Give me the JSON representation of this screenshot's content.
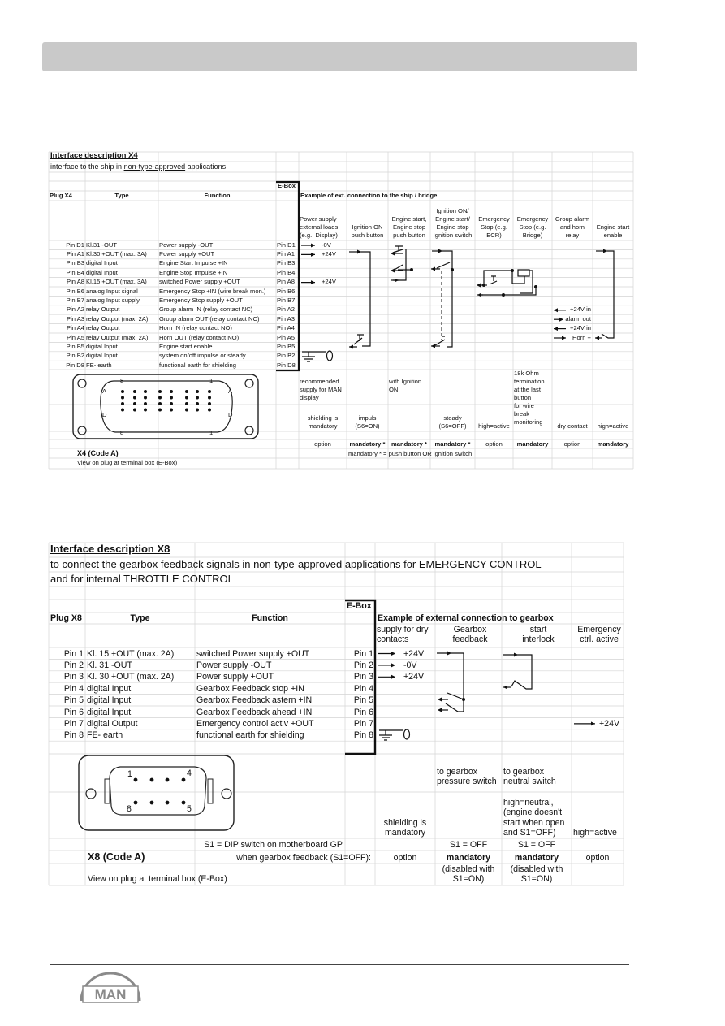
{
  "x4": {
    "title": "Interface description X4",
    "subtitle": [
      "interface to the ship in ",
      "non-type-approved",
      " applications"
    ],
    "ebox": "E-Box",
    "headers": {
      "plug": "Plug X4",
      "type": "Type",
      "function": "Function"
    },
    "example_title": "Example of ext. connection to the ship / bridge",
    "example_columns": [
      "Power supply\nexternal loads\n(e.g.  Display)",
      "Ignition ON\npush button",
      "Engine start,\nEngine stop\npush button",
      "Ignition ON/\nEngine start/\nEngine stop\nIgnition switch",
      "Emergency\nStop (e.g.\nECR)",
      "Emergency\nStop (e.g.\nBridge)",
      "Group alarm\nand horn\nrelay",
      "Engine start\nenable"
    ],
    "pins": [
      {
        "pin": "Pin D1",
        "type": "Kl.31 -OUT",
        "function": "Power supply -OUT",
        "ebox": "Pin D1",
        "supply": "-0V",
        "alarm": ""
      },
      {
        "pin": "Pin A1",
        "type": "Kl.30 +OUT (max. 3A)",
        "function": "Power supply +OUT",
        "ebox": "Pin A1",
        "supply": "+24V",
        "alarm": ""
      },
      {
        "pin": "Pin B3",
        "type": "digital Input",
        "function": "Engine Start Impulse +IN",
        "ebox": "Pin B3",
        "supply": "",
        "alarm": ""
      },
      {
        "pin": "Pin B4",
        "type": "digital Input",
        "function": "Engine Stop Impulse +IN",
        "ebox": "Pin B4",
        "supply": "",
        "alarm": ""
      },
      {
        "pin": "Pin A8",
        "type": "Kl.15 +OUT (max. 3A)",
        "function": "switched Power supply +OUT",
        "ebox": "Pin A8",
        "supply": "+24V",
        "alarm": ""
      },
      {
        "pin": "Pin B6",
        "type": "analog Input signal",
        "function": "Emergency Stop +IN (wire break mon.)",
        "ebox": "Pin B6",
        "supply": "",
        "alarm": ""
      },
      {
        "pin": "Pin B7",
        "type": "analog Input supply",
        "function": "Emergency Stop supply +OUT",
        "ebox": "Pin B7",
        "supply": "",
        "alarm": ""
      },
      {
        "pin": "Pin A2",
        "type": "relay Output",
        "function": "Group alarm IN (relay contact NC)",
        "ebox": "Pin A2",
        "supply": "",
        "alarm": "+24V in"
      },
      {
        "pin": "Pin A3",
        "type": "relay Output (max. 2A)",
        "function": "Group alarm OUT (relay contact NC)",
        "ebox": "Pin A3",
        "supply": "",
        "alarm": "alarm out"
      },
      {
        "pin": "Pin A4",
        "type": "relay Output",
        "function": "Horn IN (relay contact NO)",
        "ebox": "Pin A4",
        "supply": "",
        "alarm": "+24V in"
      },
      {
        "pin": "Pin A5",
        "type": "relay Output (max. 2A)",
        "function": "Horn OUT (relay contact NO)",
        "ebox": "Pin A5",
        "supply": "",
        "alarm": "Horn +"
      },
      {
        "pin": "Pin B5",
        "type": "digital Input",
        "function": "Engine start enable",
        "ebox": "Pin B5",
        "supply": "",
        "alarm": ""
      },
      {
        "pin": "Pin B2",
        "type": "digital Input",
        "function": "system on/off impulse or steady",
        "ebox": "Pin B2",
        "supply": "",
        "alarm": ""
      },
      {
        "pin": "Pin D8",
        "type": "FE- earth",
        "function": "functional earth for shielding",
        "ebox": "Pin D8",
        "supply": "",
        "alarm": ""
      }
    ],
    "notes1": [
      "recommended\nsupply for MAN\ndisplay",
      "",
      "with Ignition\nON",
      "",
      "",
      "18k Ohm\ntermination\nat the last\nbutton\nfor wire\nbreak\nmonitoring",
      "",
      ""
    ],
    "notes2": [
      "shielding is\nmandatory",
      "impuls\n(S6=ON)",
      "",
      "steady\n(S6=OFF)",
      "high=active",
      "",
      "dry contact",
      "high=active"
    ],
    "requirement": [
      "option",
      "mandatory *",
      "mandatory *",
      "mandatory *",
      "option",
      "mandatory",
      "option",
      "mandatory"
    ],
    "footnote": "mandatory * = push button OR ignition switch",
    "connector_title": "X4 (Code A)",
    "connector_caption": "View on plug at terminal box (E-Box)",
    "connector_labels": {
      "top_left": "8",
      "top_right": "1",
      "bottom_left": "8",
      "bottom_right": "1",
      "row_top": "A",
      "row_bottom": "D"
    }
  },
  "x8": {
    "title": "Interface description X8",
    "line2": [
      "to connect the gearbox feedback signals in ",
      "non-type-approved",
      " applications for EMERGENCY CONTROL"
    ],
    "line3": "and for internal THROTTLE CONTROL",
    "ebox": "E-Box",
    "headers": {
      "plug": "Plug X8",
      "type": "Type",
      "function": "Function"
    },
    "example_title": "Example of external connection to gearbox",
    "example_columns": [
      "supply for dry\ncontacts",
      "Gearbox\nfeedback",
      "start\ninterlock",
      "Emergency\nctrl. active"
    ],
    "pins": [
      {
        "pin": "Pin 1",
        "type": "Kl. 15 +OUT (max. 2A)",
        "function": "switched Power supply +OUT",
        "ebox": "Pin 1",
        "supply": "+24V",
        "emergency": ""
      },
      {
        "pin": "Pin 2",
        "type": "Kl. 31 -OUT",
        "function": "Power supply -OUT",
        "ebox": "Pin 2",
        "supply": "-0V",
        "emergency": ""
      },
      {
        "pin": "Pin 3",
        "type": "Kl. 30 +OUT (max. 2A)",
        "function": "Power supply +OUT",
        "ebox": "Pin 3",
        "supply": "+24V",
        "emergency": ""
      },
      {
        "pin": "Pin 4",
        "type": "digital Input",
        "function": "Gearbox Feedback stop +IN",
        "ebox": "Pin 4",
        "supply": "",
        "emergency": ""
      },
      {
        "pin": "Pin 5",
        "type": "digital Input",
        "function": "Gearbox Feedback astern +IN",
        "ebox": "Pin 5",
        "supply": "",
        "emergency": ""
      },
      {
        "pin": "Pin 6",
        "type": "digital Input",
        "function": "Gearbox Feedback ahead +IN",
        "ebox": "Pin 6",
        "supply": "",
        "emergency": ""
      },
      {
        "pin": "Pin 7",
        "type": "digital Output",
        "function": "Emergency control activ +OUT",
        "ebox": "Pin 7",
        "supply": "",
        "emergency": "+24V"
      },
      {
        "pin": "Pin 8",
        "type": "FE- earth",
        "function": "functional earth for shielding",
        "ebox": "Pin 8",
        "supply": "",
        "emergency": ""
      }
    ],
    "notes_top": [
      "",
      "to gearbox\npressure switch",
      "to gearbox\nneutral switch",
      ""
    ],
    "notes_bottom": [
      "shielding is\nmandatory",
      "",
      "high=neutral,\n(engine doesn't\nstart when open\nand S1=OFF)",
      "high=active"
    ],
    "s1_label": "S1 = DIP switch on motherboard GP",
    "s1_values": [
      "",
      "S1 = OFF",
      "S1 = OFF",
      ""
    ],
    "connector_title": "X8 (Code A)",
    "feedback_label": "when gearbox feedback (S1=OFF):",
    "requirement": [
      "option",
      "mandatory",
      "mandatory",
      "option"
    ],
    "disabled_notes": [
      "",
      "(disabled with\nS1=ON)",
      "(disabled with\nS1=ON)",
      ""
    ],
    "connector_caption": "View on plug at terminal box (E-Box)",
    "connector_labels": {
      "p1": "1",
      "p4": "4",
      "p8": "8",
      "p5": "5"
    }
  },
  "footer": {
    "logo": "MAN"
  },
  "colors": {
    "header_bar": "#c9c9c9",
    "grid": "#d4d4d4",
    "logo": "#8a8a8a"
  }
}
